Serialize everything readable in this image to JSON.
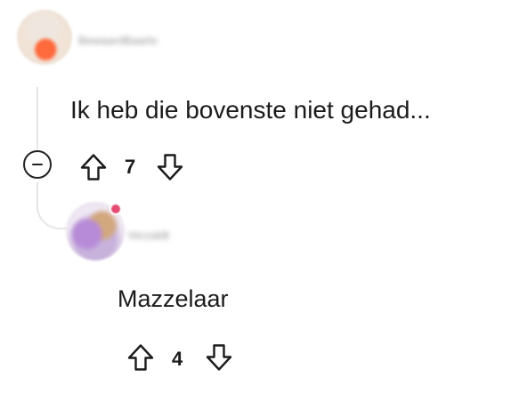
{
  "comments": [
    {
      "username": "BewaardBaarlo",
      "body": "Ik heb die bovenste niet gehad...",
      "votes": "7"
    },
    {
      "username": "Verzaldt",
      "body": "Mazzelaar",
      "votes": "4"
    }
  ],
  "icons": {
    "collapse": "minus-circle-icon",
    "upvote": "arrow-up-outline-icon",
    "downvote": "arrow-down-outline-icon"
  },
  "colors": {
    "text": "#1b1b1b",
    "thread_line": "#e6e6e6",
    "avatar_badge": "#e34b72"
  }
}
